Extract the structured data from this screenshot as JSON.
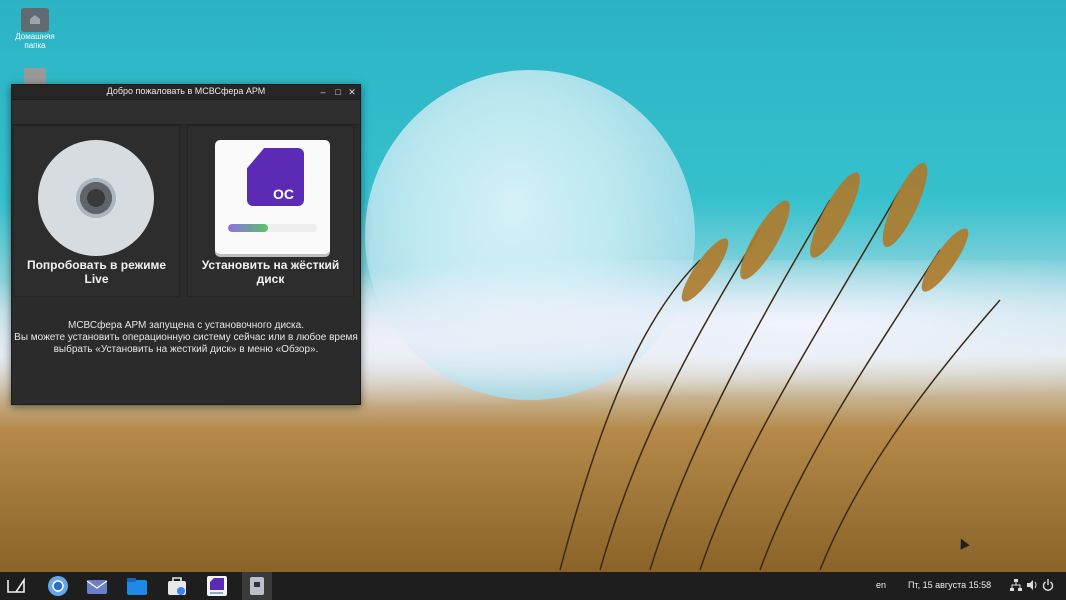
{
  "desktop": {
    "icons": [
      {
        "label": "Домашняя папка",
        "icon": "home-folder-icon"
      },
      {
        "label": "",
        "icon": "trash-icon"
      }
    ]
  },
  "window": {
    "title": "Добро пожаловать в МСВСфера АРМ",
    "controls": {
      "minimize": "–",
      "maximize": "□",
      "close": "✕"
    },
    "options": [
      {
        "label": "Попробовать в режиме Live",
        "icon": "live-cd-icon"
      },
      {
        "label": "Установить на жёсткий диск",
        "icon": "os-install-icon"
      }
    ],
    "os_logo_text": "ОС",
    "install_progress_percent": 45,
    "info_lines": [
      "МСВСфера АРМ запущена с установочного диска.",
      "Вы можете установить операционную систему сейчас или в любое время",
      "выбрать «Установить на жесткий диск» в меню «Обзор»."
    ]
  },
  "taskbar": {
    "apps": [
      "activities-icon",
      "chromium-icon",
      "mail-icon",
      "files-icon",
      "software-store-icon",
      "os-welcome-icon",
      "installer-icon"
    ],
    "language": "en",
    "clock": "Пт, 15 августа  15:58",
    "tray": [
      "network-icon",
      "volume-icon",
      "power-icon"
    ]
  },
  "colors": {
    "window_bg": "#2b2b2b",
    "taskbar_bg": "#1e1e1e",
    "os_brand": "#5b2bb5"
  }
}
